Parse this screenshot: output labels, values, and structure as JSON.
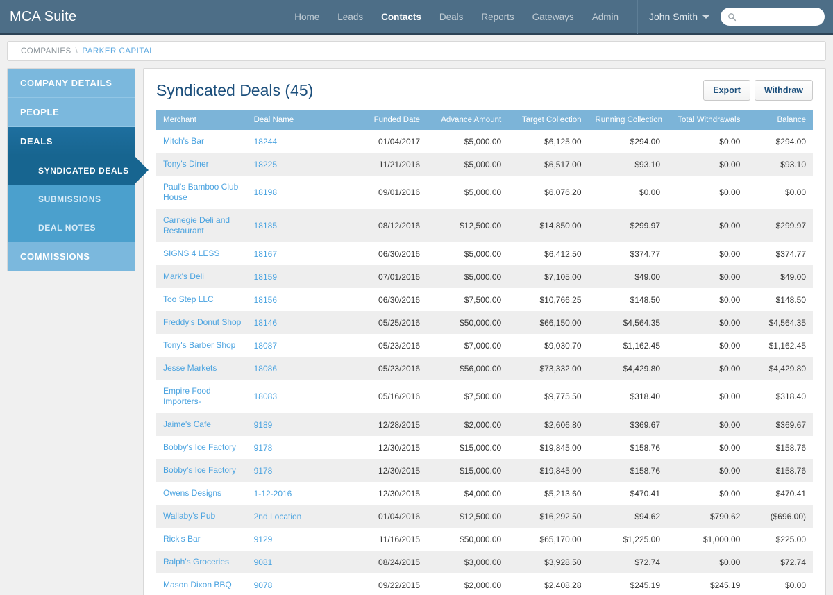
{
  "app": {
    "brand": "MCA Suite"
  },
  "nav": {
    "items": [
      {
        "label": "Home",
        "active": false
      },
      {
        "label": "Leads",
        "active": false
      },
      {
        "label": "Contacts",
        "active": true
      },
      {
        "label": "Deals",
        "active": false
      },
      {
        "label": "Reports",
        "active": false
      },
      {
        "label": "Gateways",
        "active": false
      },
      {
        "label": "Admin",
        "active": false
      }
    ],
    "user": "John Smith",
    "search_placeholder": "",
    "search_value": ""
  },
  "breadcrumb": {
    "root": "COMPANIES",
    "separator": "\\",
    "current": "PARKER CAPITAL"
  },
  "sidebar": {
    "items": [
      {
        "label": "COMPANY DETAILS",
        "level": 0,
        "active": false
      },
      {
        "label": "PEOPLE",
        "level": 0,
        "active": false
      },
      {
        "label": "DEALS",
        "level": 0,
        "active": true
      },
      {
        "label": "SYNDICATED DEALS",
        "level": 1,
        "active": true
      },
      {
        "label": "SUBMISSIONS",
        "level": 1,
        "active": false
      },
      {
        "label": "DEAL NOTES",
        "level": 1,
        "active": false
      },
      {
        "label": "COMMISSIONS",
        "level": 0,
        "active": false
      }
    ]
  },
  "main": {
    "title": "Syndicated Deals (45)",
    "export_label": "Export",
    "withdraw_label": "Withdraw",
    "table": {
      "columns": [
        "Merchant",
        "Deal Name",
        "Funded Date",
        "Advance Amount",
        "Target Collection",
        "Running Collection",
        "Total Withdrawals",
        "Balance"
      ],
      "rows": [
        [
          "Mitch's Bar",
          "18244",
          "01/04/2017",
          "$5,000.00",
          "$6,125.00",
          "$294.00",
          "$0.00",
          "$294.00"
        ],
        [
          "Tony's Diner",
          "18225",
          "11/21/2016",
          "$5,000.00",
          "$6,517.00",
          "$93.10",
          "$0.00",
          "$93.10"
        ],
        [
          "Paul's Bamboo Club House",
          "18198",
          "09/01/2016",
          "$5,000.00",
          "$6,076.20",
          "$0.00",
          "$0.00",
          "$0.00"
        ],
        [
          "Carnegie Deli and Restaurant",
          "18185",
          "08/12/2016",
          "$12,500.00",
          "$14,850.00",
          "$299.97",
          "$0.00",
          "$299.97"
        ],
        [
          "SIGNS 4 LESS",
          "18167",
          "06/30/2016",
          "$5,000.00",
          "$6,412.50",
          "$374.77",
          "$0.00",
          "$374.77"
        ],
        [
          "Mark's Deli",
          "18159",
          "07/01/2016",
          "$5,000.00",
          "$7,105.00",
          "$49.00",
          "$0.00",
          "$49.00"
        ],
        [
          "Too Step LLC",
          "18156",
          "06/30/2016",
          "$7,500.00",
          "$10,766.25",
          "$148.50",
          "$0.00",
          "$148.50"
        ],
        [
          "Freddy's Donut Shop",
          "18146",
          "05/25/2016",
          "$50,000.00",
          "$66,150.00",
          "$4,564.35",
          "$0.00",
          "$4,564.35"
        ],
        [
          "Tony's Barber Shop",
          "18087",
          "05/23/2016",
          "$7,000.00",
          "$9,030.70",
          "$1,162.45",
          "$0.00",
          "$1,162.45"
        ],
        [
          "Jesse Markets",
          "18086",
          "05/23/2016",
          "$56,000.00",
          "$73,332.00",
          "$4,429.80",
          "$0.00",
          "$4,429.80"
        ],
        [
          "Empire Food Importers-",
          "18083",
          "05/16/2016",
          "$7,500.00",
          "$9,775.50",
          "$318.40",
          "$0.00",
          "$318.40"
        ],
        [
          "Jaime's Cafe",
          "9189",
          "12/28/2015",
          "$2,000.00",
          "$2,606.80",
          "$369.67",
          "$0.00",
          "$369.67"
        ],
        [
          "Bobby's Ice Factory",
          "9178",
          "12/30/2015",
          "$15,000.00",
          "$19,845.00",
          "$158.76",
          "$0.00",
          "$158.76"
        ],
        [
          "Bobby's Ice Factory",
          "9178",
          "12/30/2015",
          "$15,000.00",
          "$19,845.00",
          "$158.76",
          "$0.00",
          "$158.76"
        ],
        [
          "Owens Designs",
          "1-12-2016",
          "12/30/2015",
          "$4,000.00",
          "$5,213.60",
          "$470.41",
          "$0.00",
          "$470.41"
        ],
        [
          "Wallaby's Pub",
          "2nd Location",
          "01/04/2016",
          "$12,500.00",
          "$16,292.50",
          "$94.62",
          "$790.62",
          "($696.00)"
        ],
        [
          "Rick's Bar",
          "9129",
          "11/16/2015",
          "$50,000.00",
          "$65,170.00",
          "$1,225.00",
          "$1,000.00",
          "$225.00"
        ],
        [
          "Ralph's Groceries",
          "9081",
          "08/24/2015",
          "$3,000.00",
          "$3,928.50",
          "$72.74",
          "$0.00",
          "$72.74"
        ],
        [
          "Mason Dixon BBQ",
          "9078",
          "09/22/2015",
          "$2,000.00",
          "$2,408.28",
          "$245.19",
          "$245.19",
          "$0.00"
        ]
      ]
    }
  },
  "colors": {
    "topbar": "#4d6e87",
    "sidebar_item": "#7bb8dd",
    "sidebar_active": "#176590",
    "table_header": "#7cb4d8",
    "link": "#4aa3e0",
    "title": "#1c4f7c"
  }
}
